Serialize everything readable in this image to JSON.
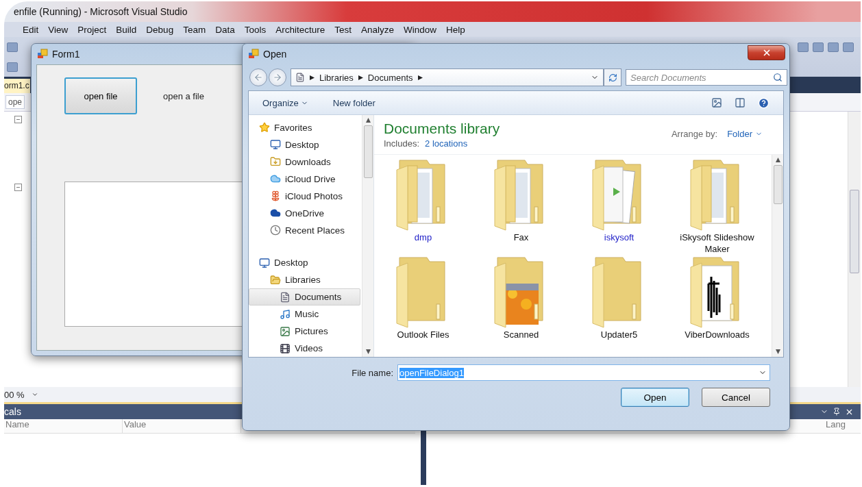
{
  "vs_window": {
    "title": "enfile (Running) - Microsoft Visual Studio",
    "menu": [
      "Edit",
      "View",
      "Project",
      "Build",
      "Debug",
      "Team",
      "Data",
      "Tools",
      "Architecture",
      "Test",
      "Analyze",
      "Window",
      "Help"
    ],
    "editor": {
      "tab": "orm1.c",
      "member_dropdown": "ope",
      "zoom": "00 %"
    },
    "locals": {
      "title": "cals",
      "columns": [
        "Name",
        "Value"
      ]
    },
    "right_panel": {
      "columns": [
        "Lang"
      ]
    }
  },
  "form1": {
    "title": "Form1",
    "button": {
      "label": "open file",
      "focused": true
    },
    "label": "open a file"
  },
  "open_dialog": {
    "title": "Open",
    "breadcrumb": [
      "Libraries",
      "Documents"
    ],
    "search": {
      "placeholder": "Search Documents"
    },
    "toolbar": [
      {
        "label": "Organize",
        "dropdown": true
      },
      {
        "label": "New folder",
        "dropdown": false
      }
    ],
    "nav": [
      {
        "label": "Favorites",
        "kind": "star",
        "selected": false,
        "children": [
          {
            "label": "Desktop",
            "kind": "desktop",
            "selected": false
          },
          {
            "label": "Downloads",
            "kind": "downloads",
            "selected": false
          },
          {
            "label": "iCloud Drive",
            "kind": "cloud",
            "selected": false
          },
          {
            "label": "iCloud Photos",
            "kind": "photos",
            "selected": false
          },
          {
            "label": "OneDrive",
            "kind": "onedrive",
            "selected": false
          },
          {
            "label": "Recent Places",
            "kind": "recent",
            "selected": false
          }
        ]
      },
      {
        "label": "Desktop",
        "kind": "desktop",
        "selected": false,
        "children": [
          {
            "label": "Libraries",
            "kind": "libraries",
            "selected": false,
            "children": [
              {
                "label": "Documents",
                "kind": "document",
                "selected": true
              },
              {
                "label": "Music",
                "kind": "music",
                "selected": false
              },
              {
                "label": "Pictures",
                "kind": "pictures",
                "selected": false
              },
              {
                "label": "Videos",
                "kind": "videos",
                "selected": false
              }
            ]
          }
        ]
      }
    ],
    "library": {
      "title": "Documents library",
      "includes_label": "Includes:",
      "includes_link": "2 locations",
      "arrange_label": "Arrange by:",
      "arrange_value": "Folder"
    },
    "files": [
      {
        "name": "dmp",
        "kind": "papers",
        "compressed": true
      },
      {
        "name": "Fax",
        "kind": "papers",
        "compressed": false
      },
      {
        "name": "iskysoft",
        "kind": "sheets",
        "compressed": true
      },
      {
        "name": "iSkysoft Slideshow Maker",
        "kind": "papers",
        "compressed": false
      },
      {
        "name": "Outlook Files",
        "kind": "empty",
        "compressed": false
      },
      {
        "name": "Scanned",
        "kind": "photo",
        "compressed": false
      },
      {
        "name": "Updater5",
        "kind": "empty",
        "compressed": false
      },
      {
        "name": "ViberDownloads",
        "kind": "figure",
        "compressed": false
      }
    ],
    "file_name": {
      "label": "File name:",
      "value": "openFileDialog1",
      "value_selected": true
    },
    "buttons": [
      {
        "label": "Open",
        "default": true
      },
      {
        "label": "Cancel",
        "default": false
      }
    ]
  }
}
